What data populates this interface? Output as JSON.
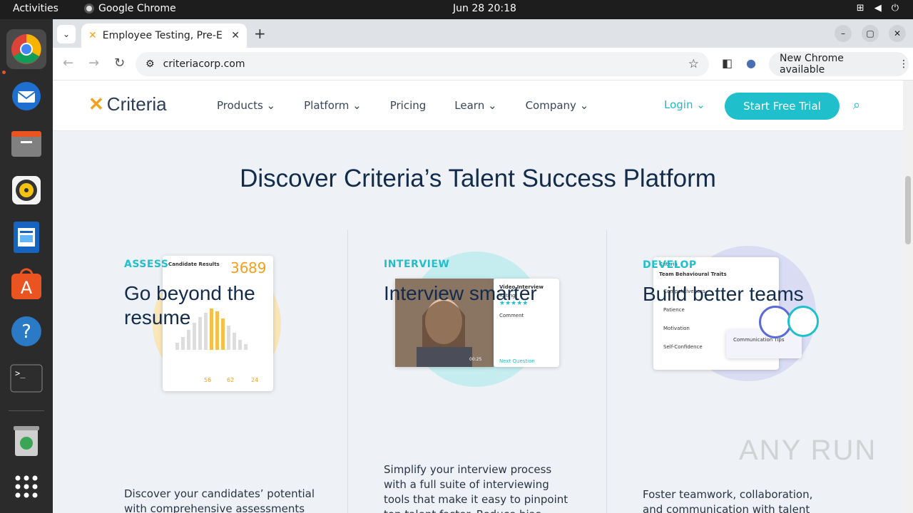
{
  "system": {
    "activities": "Activities",
    "app_name": "Google Chrome",
    "clock": "Jun 28  20:18"
  },
  "browser": {
    "tab_title": "Employee Testing, Pre-E",
    "url": "criteriacorp.com",
    "update_label": "New Chrome available"
  },
  "site": {
    "logo_text": "Criteria",
    "menu": [
      "Products",
      "Platform",
      "Pricing",
      "Learn",
      "Company"
    ],
    "login": "Login",
    "cta": "Start Free Trial",
    "hero_title": "Discover Criteria’s Talent Success Platform",
    "columns": [
      {
        "kicker": "ASSESS",
        "title": "Go beyond the resume",
        "text": "Discover your candidates’ potential with comprehensive assessments"
      },
      {
        "kicker": "INTERVIEW",
        "title": "Interview smarter",
        "text": "Simplify your interview process with a full suite of interviewing tools that make it easy to pinpoint top talent faster. Reduce bias"
      },
      {
        "kicker": "DEVELOP",
        "title": "Build better teams",
        "text": "Foster teamwork, collaboration, and communication with talent"
      }
    ],
    "illus": {
      "candidate_results": "Candidate Results",
      "score_a": "36",
      "score_b": "89",
      "scores_small": [
        "56",
        "62",
        "24"
      ],
      "video_interview": "Video Interview",
      "rating": "Rating",
      "comment": "Comment",
      "next_question": "Next Question",
      "time": "00:25",
      "team_traits": "Team Behavioural Traits",
      "traits": [
        "Competitiveness",
        "Patience",
        "Motivation",
        "Self-Confidence"
      ],
      "tips": "Communication Tips"
    }
  },
  "watermark": "ANY RUN"
}
